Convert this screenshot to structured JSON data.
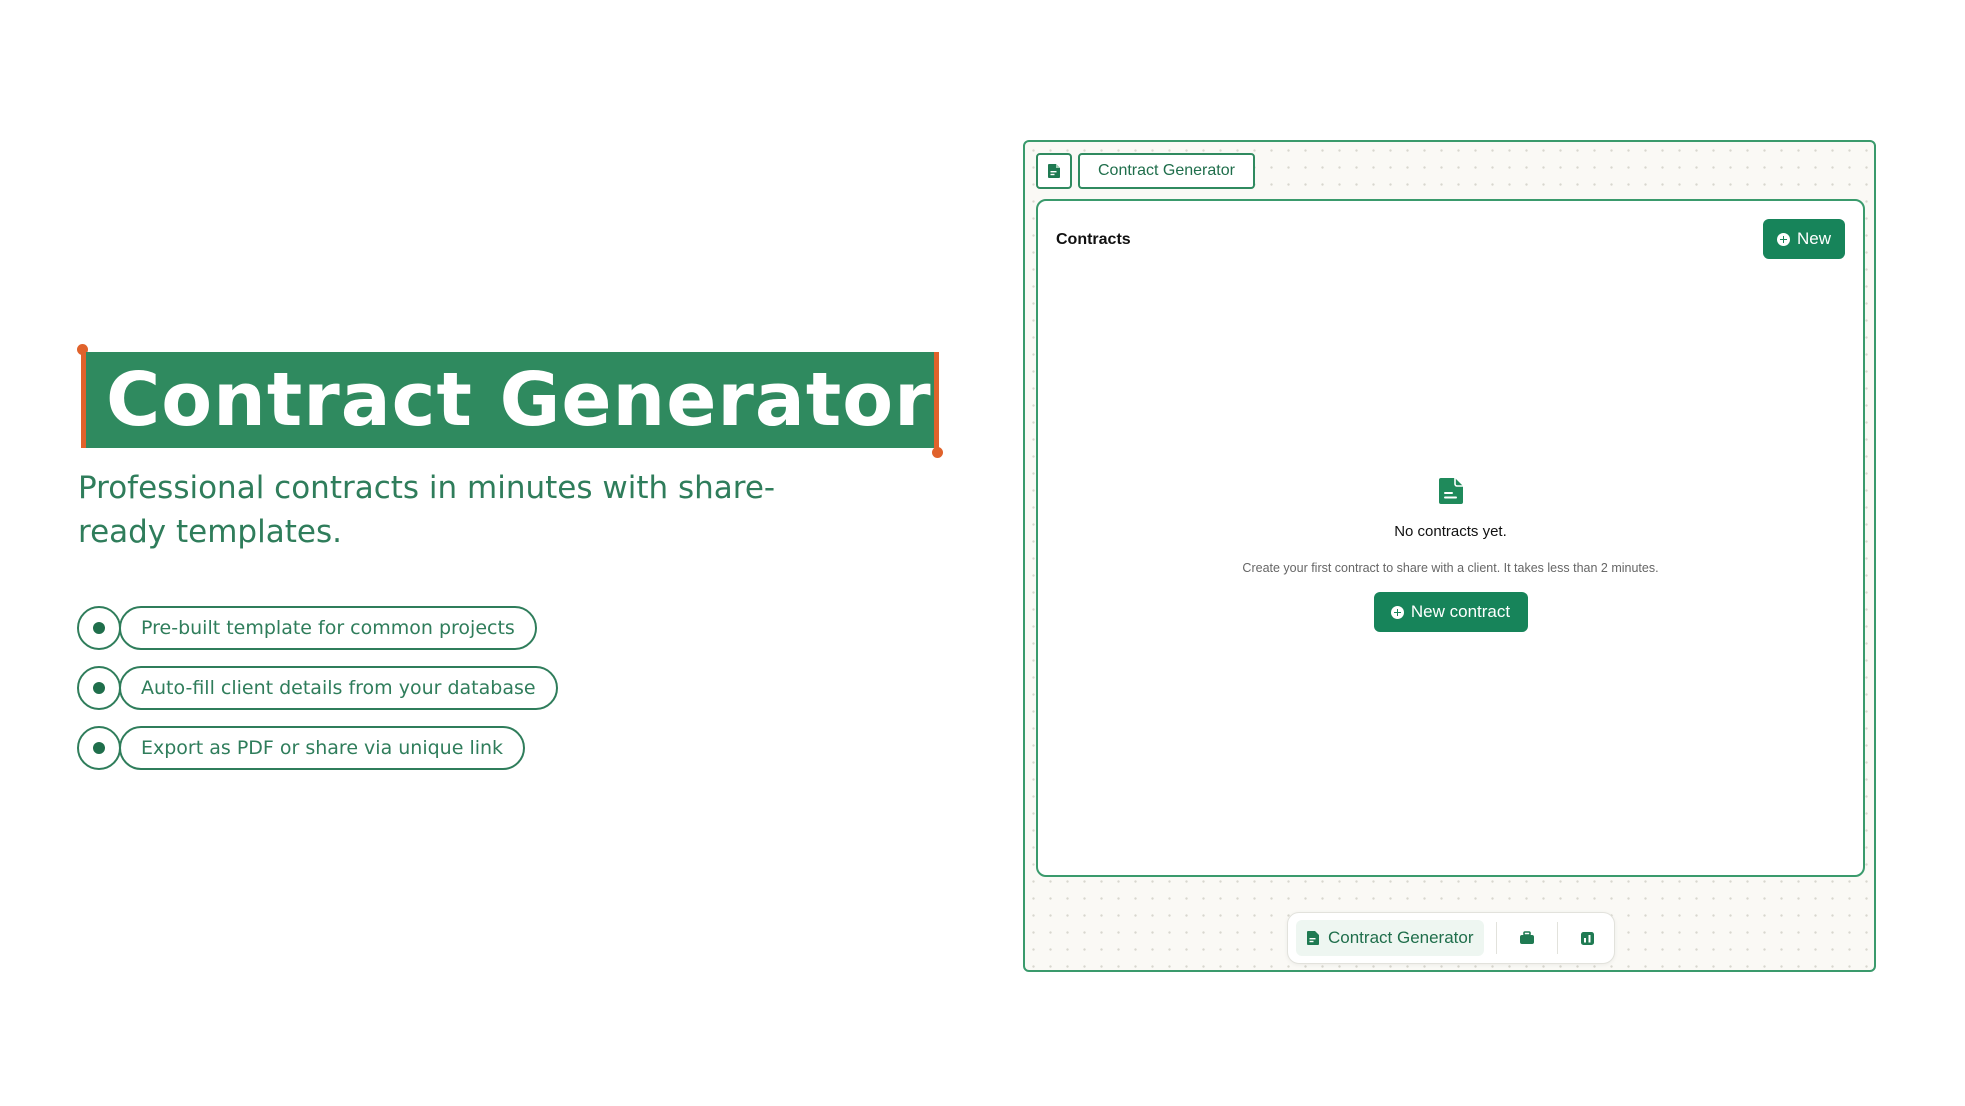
{
  "hero": {
    "title": "Contract Generator",
    "subtitle": "Professional contracts in minutes with share-ready templates.",
    "features": [
      "Pre-built template for common projects",
      "Auto-fill client details from your database",
      "Export as PDF or share via unique link"
    ]
  },
  "window": {
    "tab": {
      "icon": "document-icon",
      "title": "Contract Generator"
    },
    "panel": {
      "title": "Contracts",
      "new_button": "New"
    },
    "empty_state": {
      "icon": "document-icon",
      "title": "No contracts yet.",
      "description": "Create your first contract to share with a client. It takes less than 2 minutes.",
      "button": "New contract"
    },
    "dock": {
      "active_label": "Contract Generator",
      "active_icon": "document-icon",
      "items": [
        "briefcase-icon",
        "bar-chart-icon"
      ]
    }
  },
  "colors": {
    "brand_green": "#2f8a5f",
    "button_green": "#17845a",
    "accent_orange": "#e0622b"
  }
}
